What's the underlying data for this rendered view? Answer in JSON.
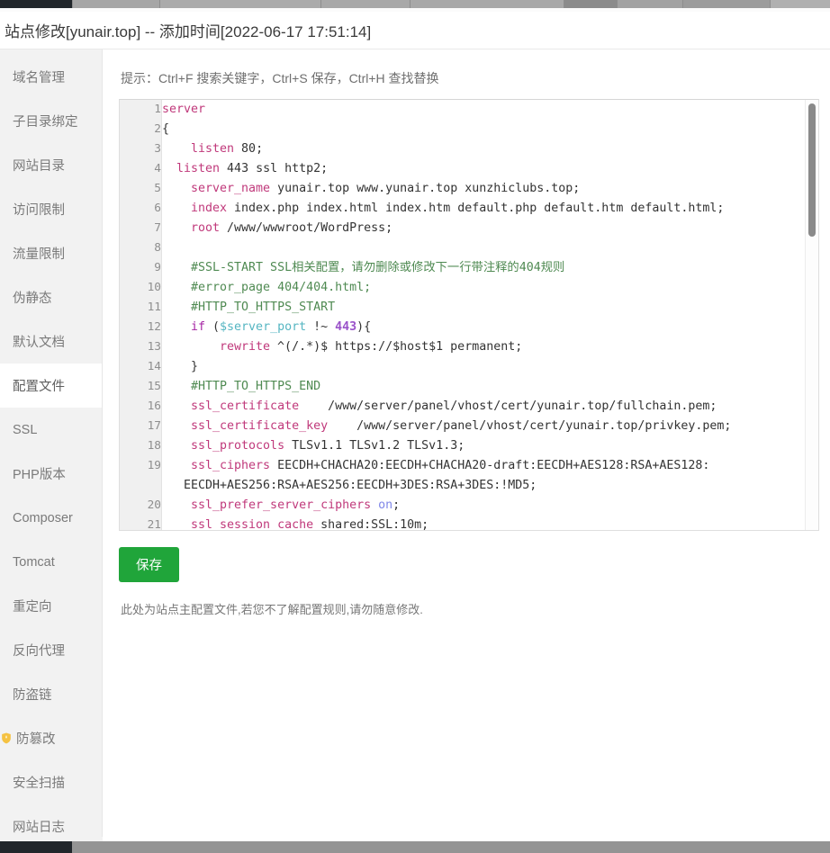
{
  "window": {
    "title": "站点修改[yunair.top] -- 添加时间[2022-06-17 17:51:14]"
  },
  "sidebar": {
    "items": [
      {
        "label": "域名管理",
        "active": false,
        "icon": null
      },
      {
        "label": "子目录绑定",
        "active": false,
        "icon": null
      },
      {
        "label": "网站目录",
        "active": false,
        "icon": null
      },
      {
        "label": "访问限制",
        "active": false,
        "icon": null
      },
      {
        "label": "流量限制",
        "active": false,
        "icon": null
      },
      {
        "label": "伪静态",
        "active": false,
        "icon": null
      },
      {
        "label": "默认文档",
        "active": false,
        "icon": null
      },
      {
        "label": "配置文件",
        "active": true,
        "icon": null
      },
      {
        "label": "SSL",
        "active": false,
        "icon": null
      },
      {
        "label": "PHP版本",
        "active": false,
        "icon": null
      },
      {
        "label": "Composer",
        "active": false,
        "icon": null
      },
      {
        "label": "Tomcat",
        "active": false,
        "icon": null
      },
      {
        "label": "重定向",
        "active": false,
        "icon": null
      },
      {
        "label": "反向代理",
        "active": false,
        "icon": null
      },
      {
        "label": "防盗链",
        "active": false,
        "icon": null
      },
      {
        "label": "防篡改",
        "active": false,
        "icon": "shield-icon"
      },
      {
        "label": "安全扫描",
        "active": false,
        "icon": null
      },
      {
        "label": "网站日志",
        "active": false,
        "icon": null
      }
    ]
  },
  "main": {
    "hint": "提示：Ctrl+F 搜索关键字，Ctrl+S 保存，Ctrl+H 查找替换",
    "save_label": "保存",
    "footer_note": "此处为站点主配置文件,若您不了解配置规则,请勿随意修改."
  },
  "editor": {
    "language": "nginx",
    "first_visible_line": 1,
    "last_visible_line": 21,
    "lines": [
      {
        "n": "1",
        "text": "server"
      },
      {
        "n": "2",
        "text": "{"
      },
      {
        "n": "3",
        "text": "    listen 80;"
      },
      {
        "n": "4",
        "text": "  listen 443 ssl http2;"
      },
      {
        "n": "5",
        "text": "    server_name yunair.top www.yunair.top xunzhiclubs.top;"
      },
      {
        "n": "6",
        "text": "    index index.php index.html index.htm default.php default.htm default.html;"
      },
      {
        "n": "7",
        "text": "    root /www/wwwroot/WordPress;"
      },
      {
        "n": "8",
        "text": ""
      },
      {
        "n": "9",
        "text": "    #SSL-START SSL相关配置，请勿删除或修改下一行带注释的404规则"
      },
      {
        "n": "10",
        "text": "    #error_page 404/404.html;"
      },
      {
        "n": "11",
        "text": "    #HTTP_TO_HTTPS_START"
      },
      {
        "n": "12",
        "text": "    if ($server_port !~ 443){"
      },
      {
        "n": "13",
        "text": "        rewrite ^(/.*)$ https://$host$1 permanent;"
      },
      {
        "n": "14",
        "text": "    }"
      },
      {
        "n": "15",
        "text": "    #HTTP_TO_HTTPS_END"
      },
      {
        "n": "16",
        "text": "    ssl_certificate    /www/server/panel/vhost/cert/yunair.top/fullchain.pem;"
      },
      {
        "n": "17",
        "text": "    ssl_certificate_key    /www/server/panel/vhost/cert/yunair.top/privkey.pem;"
      },
      {
        "n": "18",
        "text": "    ssl_protocols TLSv1.1 TLSv1.2 TLSv1.3;"
      },
      {
        "n": "19",
        "text": "    ssl_ciphers EECDH+CHACHA20:EECDH+CHACHA20-draft:EECDH+AES128:RSA+AES128:EECDH+AES256:RSA+AES256:EECDH+3DES:RSA+3DES:!MD5;"
      },
      {
        "n": "20",
        "text": "    ssl_prefer_server_ciphers on;"
      },
      {
        "n": "21",
        "text": "    ssl_session_cache shared:SSL:10m;"
      }
    ]
  },
  "colors": {
    "accent_green": "#20a53a",
    "keyword_pink": "#c0397b",
    "comment_green": "#4f8a52",
    "variable_cyan": "#56b6c2",
    "number_purple": "#9a52c9",
    "sidebar_bg": "#f2f2f2",
    "shield_yellow": "#f5c242"
  }
}
